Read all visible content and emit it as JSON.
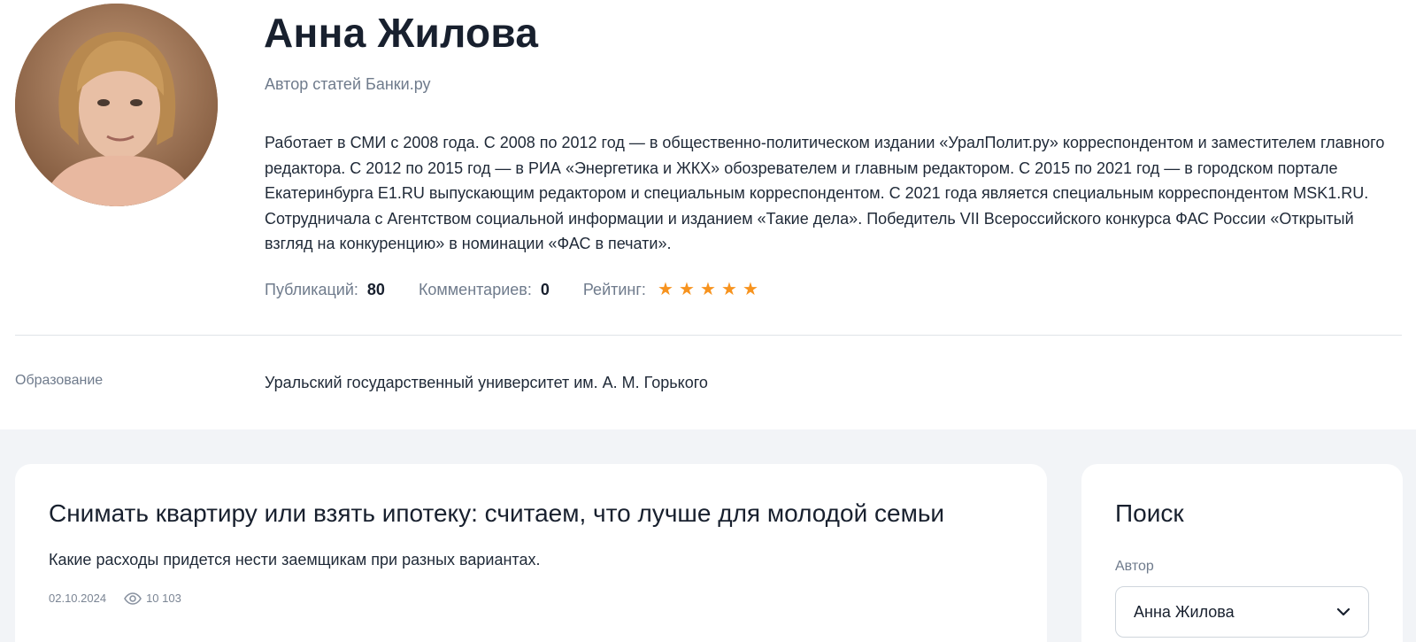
{
  "profile": {
    "name": "Анна Жилова",
    "role": "Автор статей Банки.ру",
    "bio": "Работает в СМИ с 2008 года. С 2008 по 2012 год — в общественно-политическом издании «УралПолит.ру» корреспондентом и заместителем главного редактора. С 2012 по 2015 год — в РИА «Энергетика и ЖКХ» обозревателем и главным редактором. С 2015 по 2021 год — в городском портале Екатеринбурга E1.RU выпускающим редактором и специальным корреспондентом. С 2021 года является специальным корреспондентом MSK1.RU. Сотрудничала с Агентством социальной информации и изданием «Такие дела». Победитель VII Всероссийского конкурса ФАС России «Открытый взгляд на конкуренцию» в номинации «ФАС в печати».",
    "stats": {
      "publications_label": "Публикаций:",
      "publications_value": "80",
      "comments_label": "Комментариев:",
      "comments_value": "0",
      "rating_label": "Рейтинг:",
      "rating_stars": 5,
      "star_color": "#f7931e"
    },
    "education": {
      "label": "Образование",
      "value": "Уральский государственный университет им. А. М. Горького"
    }
  },
  "article": {
    "title": "Снимать квартиру или взять ипотеку: считаем, что лучше для молодой семьи",
    "lead": "Какие расходы придется нести заемщикам при разных вариантах.",
    "date": "02.10.2024",
    "views": "10 103",
    "views_icon": "eye-icon"
  },
  "search": {
    "title": "Поиск",
    "author_label": "Автор",
    "author_value": "Анна Жилова",
    "select_icon": "chevron-down-icon"
  },
  "colors": {
    "page_bg_lower": "#f2f4f7",
    "text_primary": "#18202e",
    "text_muted": "#6f7b8c",
    "accent_star": "#f7931e"
  }
}
